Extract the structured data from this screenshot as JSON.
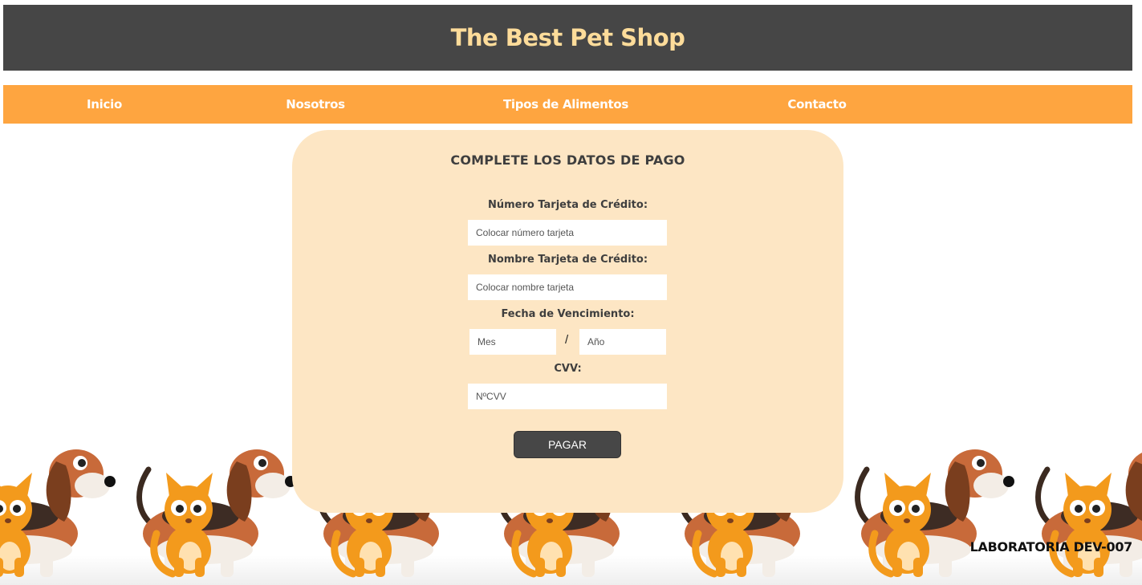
{
  "header": {
    "title": "The Best Pet Shop"
  },
  "nav": {
    "items": [
      {
        "label": "Inicio"
      },
      {
        "label": "Nosotros"
      },
      {
        "label": "Tipos de Alimentos"
      },
      {
        "label": "Contacto"
      }
    ]
  },
  "form": {
    "title": "COMPLETE LOS DATOS DE PAGO",
    "card_number": {
      "label": "Número Tarjeta de Crédito:",
      "placeholder": "Colocar número tarjeta",
      "value": ""
    },
    "card_name": {
      "label": "Nombre Tarjeta de Crédito:",
      "placeholder": "Colocar nombre tarjeta",
      "value": ""
    },
    "expiry": {
      "label": "Fecha de Vencimiento:",
      "month_placeholder": "Mes",
      "year_placeholder": "Año",
      "separator": "/"
    },
    "cvv": {
      "label": "CVV:",
      "placeholder": "NºCVV",
      "value": ""
    },
    "submit_label": "PAGAR"
  },
  "footer": {
    "label": "LABORATORIA DEV-007"
  },
  "colors": {
    "header_bg": "#464646",
    "title_color": "#fddc9a",
    "nav_bg": "#fea540",
    "card_bg": "#fde6c4",
    "button_bg": "#474747"
  },
  "background_illustration": {
    "icons": [
      "dog-illustration",
      "cat-illustration"
    ]
  }
}
